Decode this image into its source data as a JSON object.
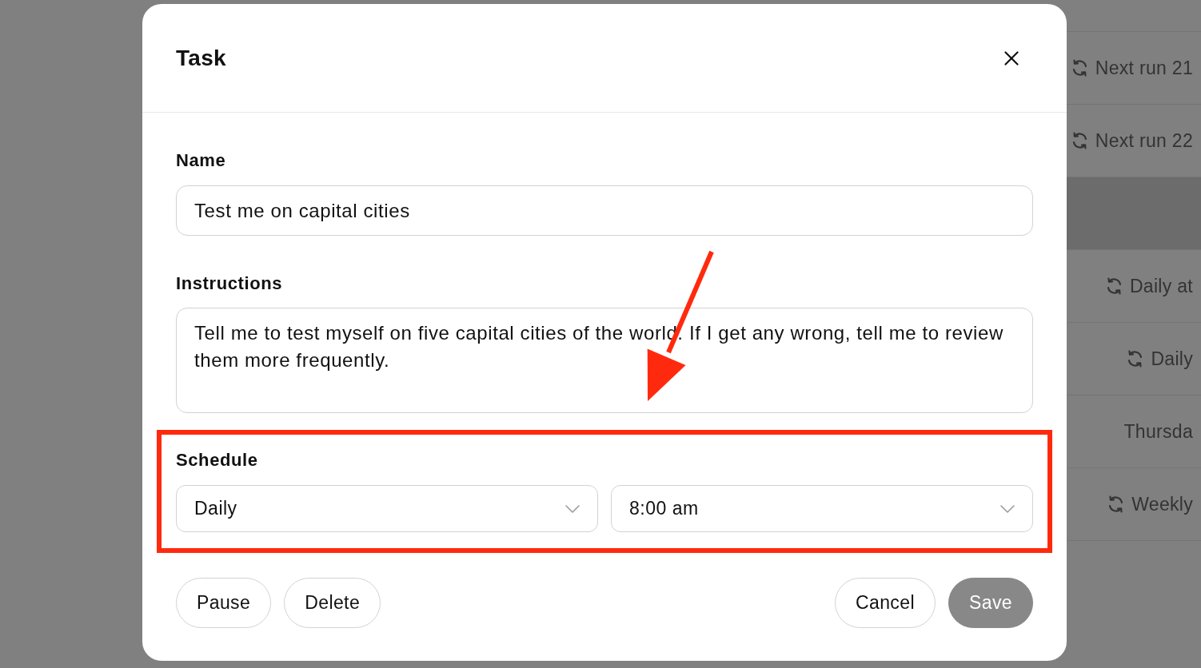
{
  "background_list": {
    "rows": [
      {
        "text": "Next run 21",
        "recurring": true,
        "selected": false
      },
      {
        "text": "Next run 22",
        "recurring": true,
        "selected": false
      },
      {
        "recurring": false,
        "selected": true
      },
      {
        "text": "Daily at",
        "recurring": true,
        "selected": false
      },
      {
        "text": "Daily",
        "recurring": true,
        "selected": false
      },
      {
        "text": "Thursda",
        "recurring": false,
        "selected": false
      },
      {
        "text": "Weekly",
        "recurring": true,
        "selected": false
      }
    ]
  },
  "dialog": {
    "title": "Task",
    "name_field": {
      "label": "Name",
      "value": "Test me on capital cities"
    },
    "instructions_field": {
      "label": "Instructions",
      "value": "Tell me to test myself on five capital cities of the world. If I get any wrong, tell me to review them more frequently."
    },
    "schedule": {
      "label": "Schedule",
      "highlighted": true,
      "frequency": "Daily",
      "time": "8:00 am"
    },
    "left_buttons": [
      {
        "label": "Pause",
        "kind": "outline",
        "disabled": false
      },
      {
        "label": "Delete",
        "kind": "outline",
        "disabled": false
      }
    ],
    "right_buttons": [
      {
        "label": "Cancel",
        "kind": "outline",
        "disabled": false
      },
      {
        "label": "Save",
        "kind": "primary",
        "disabled": true
      }
    ]
  },
  "annotations": [
    {
      "kind": "arrow"
    }
  ]
}
